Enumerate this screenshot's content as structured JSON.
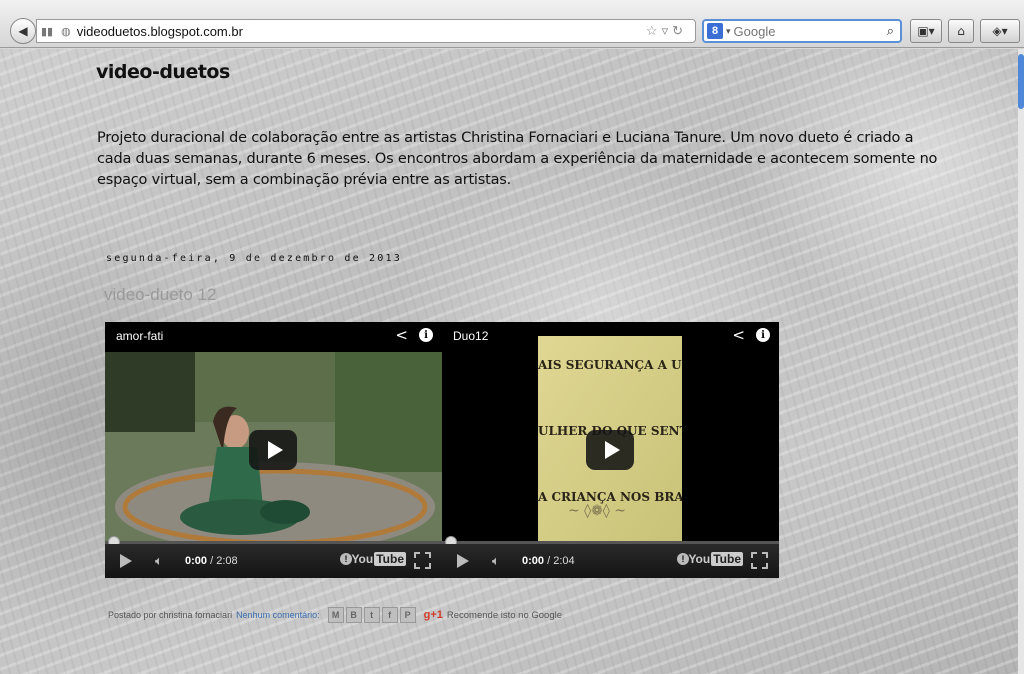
{
  "browser": {
    "url": "videoduetos.blogspot.com.br",
    "search_engine_badge": "8",
    "search_placeholder": "Google"
  },
  "blog": {
    "title": "video-duetos",
    "description": "Projeto duracional de colaboração entre as artistas Christina Fornaciari e Luciana Tanure. Um novo dueto é criado a cada duas semanas, durante 6 meses. Os encontros abordam a experiência da maternidade e acontecem somente no espaço virtual, sem a combinação prévia entre as artistas."
  },
  "post": {
    "date": "segunda-feira, 9 de dezembro de 2013",
    "title": "video-dueto 12",
    "videos": [
      {
        "title": "amor-fati",
        "current": "0:00",
        "duration": " / 2:08"
      },
      {
        "title": "Duo12",
        "current": "0:00",
        "duration": " / 2:04",
        "card_lines": [
          "AIS SEGURANÇA A UMA",
          "ULHER DO QUE SENTIR",
          "A CRIANÇA NOS BRAÇ"
        ]
      }
    ],
    "youtube_label": "You",
    "youtube_tube": "Tube",
    "footer": {
      "posted_by": "Postado por christina fornaciari",
      "comments": "Nenhum comentário:",
      "share_icons": [
        "M",
        "B",
        "t",
        "f",
        "P"
      ],
      "gplus": "g+1",
      "recommend": "Recomende isto no Google"
    }
  },
  "colors": {
    "accent": "#4f88d8",
    "link": "#3a6fb0"
  }
}
